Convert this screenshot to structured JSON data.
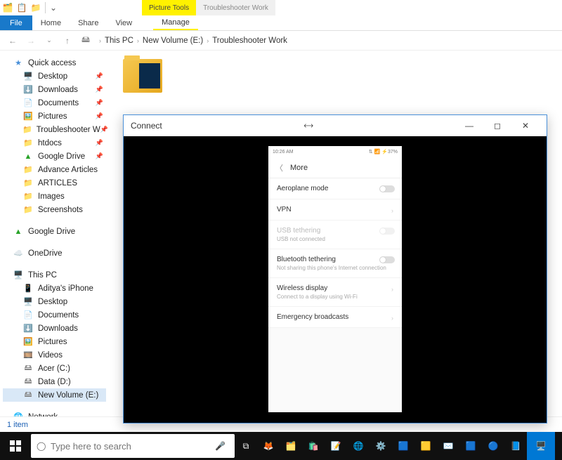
{
  "qat": {
    "chevron": "⌄"
  },
  "context_tabs": {
    "tool": "Picture Tools",
    "title": "Troubleshooter Work"
  },
  "ribbon": {
    "file": "File",
    "home": "Home",
    "share": "Share",
    "view": "View",
    "manage": "Manage"
  },
  "breadcrumb": {
    "root": "This PC",
    "vol": "New Volume (E:)",
    "folder": "Troubleshooter Work"
  },
  "sidebar": {
    "quick": "Quick access",
    "quick_items": [
      "Desktop",
      "Downloads",
      "Documents",
      "Pictures",
      "Troubleshooter W",
      "htdocs",
      "Google Drive",
      "Advance Articles",
      "ARTICLES",
      "Images",
      "Screenshots"
    ],
    "gdrive": "Google Drive",
    "onedrive": "OneDrive",
    "thispc": "This PC",
    "pc_items": [
      "Aditya's iPhone",
      "Desktop",
      "Documents",
      "Downloads",
      "Pictures",
      "Videos",
      "Acer (C:)",
      "Data (D:)",
      "New Volume (E:)"
    ],
    "network": "Network"
  },
  "content": {
    "folder_name": ""
  },
  "connect": {
    "title": "Connect",
    "phone": {
      "time": "10:26 AM",
      "status_right": "⇅ 📶 ⚡37%",
      "header": "More",
      "rows": {
        "airplane": "Aeroplane mode",
        "vpn": "VPN",
        "usb_t": "USB tethering",
        "usb_sub": "USB not connected",
        "bt_t": "Bluetooth tethering",
        "bt_sub": "Not sharing this phone's Internet connection",
        "wd": "Wireless display",
        "wd_sub": "Connect to a display using Wi-Fi",
        "eb": "Emergency broadcasts"
      }
    }
  },
  "statusbar": {
    "count": "1 item"
  },
  "taskbar": {
    "search_placeholder": "Type here to search"
  }
}
